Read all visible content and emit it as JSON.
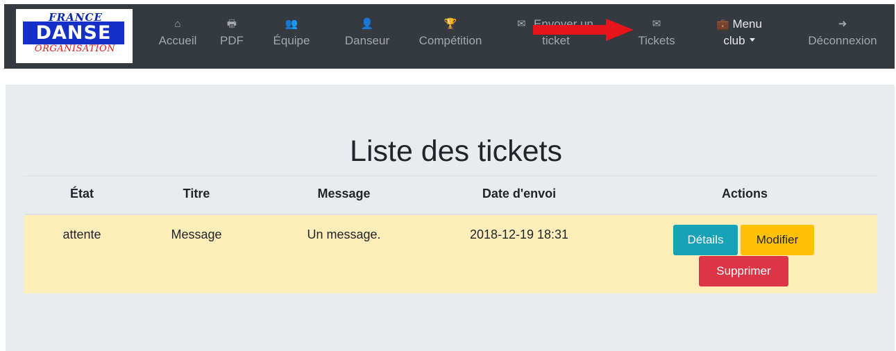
{
  "brand": {
    "line1": "FRANCE",
    "line2": "DANSE",
    "line3": "ORGANISATION"
  },
  "nav": {
    "items": [
      {
        "key": "accueil",
        "icon": "home-icon",
        "glyph": "⌂",
        "label": "Accueil"
      },
      {
        "key": "pdf",
        "icon": "printer-icon",
        "glyph": "🖶",
        "label": "PDF"
      },
      {
        "key": "equipe",
        "icon": "users-icon",
        "glyph": "👥",
        "label": "Équipe"
      },
      {
        "key": "danseur",
        "icon": "user-edit-icon",
        "glyph": "👤",
        "label": "Danseur"
      },
      {
        "key": "competition",
        "icon": "trophy-icon",
        "glyph": "🏆",
        "label": "Compétition"
      },
      {
        "key": "envoyer",
        "icon": "envelope-open-icon",
        "glyph": "✉",
        "label": "Envoyer un",
        "label2": "ticket"
      },
      {
        "key": "tickets",
        "icon": "envelope-icon",
        "glyph": "✉",
        "label": "Tickets"
      },
      {
        "key": "menu-club",
        "icon": "briefcase-icon",
        "glyph": "💼",
        "label": "Menu",
        "label2": "club"
      },
      {
        "key": "deconnexion",
        "icon": "sign-out-icon",
        "glyph": "➜",
        "label": "Déconnexion"
      }
    ]
  },
  "annotation": {
    "arrow_color": "#e8141b"
  },
  "main": {
    "title": "Liste des tickets",
    "table": {
      "headers": [
        "État",
        "Titre",
        "Message",
        "Date d'envoi",
        "Actions"
      ],
      "rows": [
        {
          "etat": "attente",
          "titre": "Message",
          "message": "Un message.",
          "date": "2018-12-19 18:31",
          "actions": {
            "details": "Détails",
            "modifier": "Modifier",
            "supprimer": "Supprimer"
          }
        }
      ]
    }
  },
  "colors": {
    "navbar": "#343a40",
    "panel": "#e9ecef",
    "row_warning": "#ffeeba",
    "btn_info": "#17a2b8",
    "btn_warning": "#ffc107",
    "btn_danger": "#dc3545"
  }
}
